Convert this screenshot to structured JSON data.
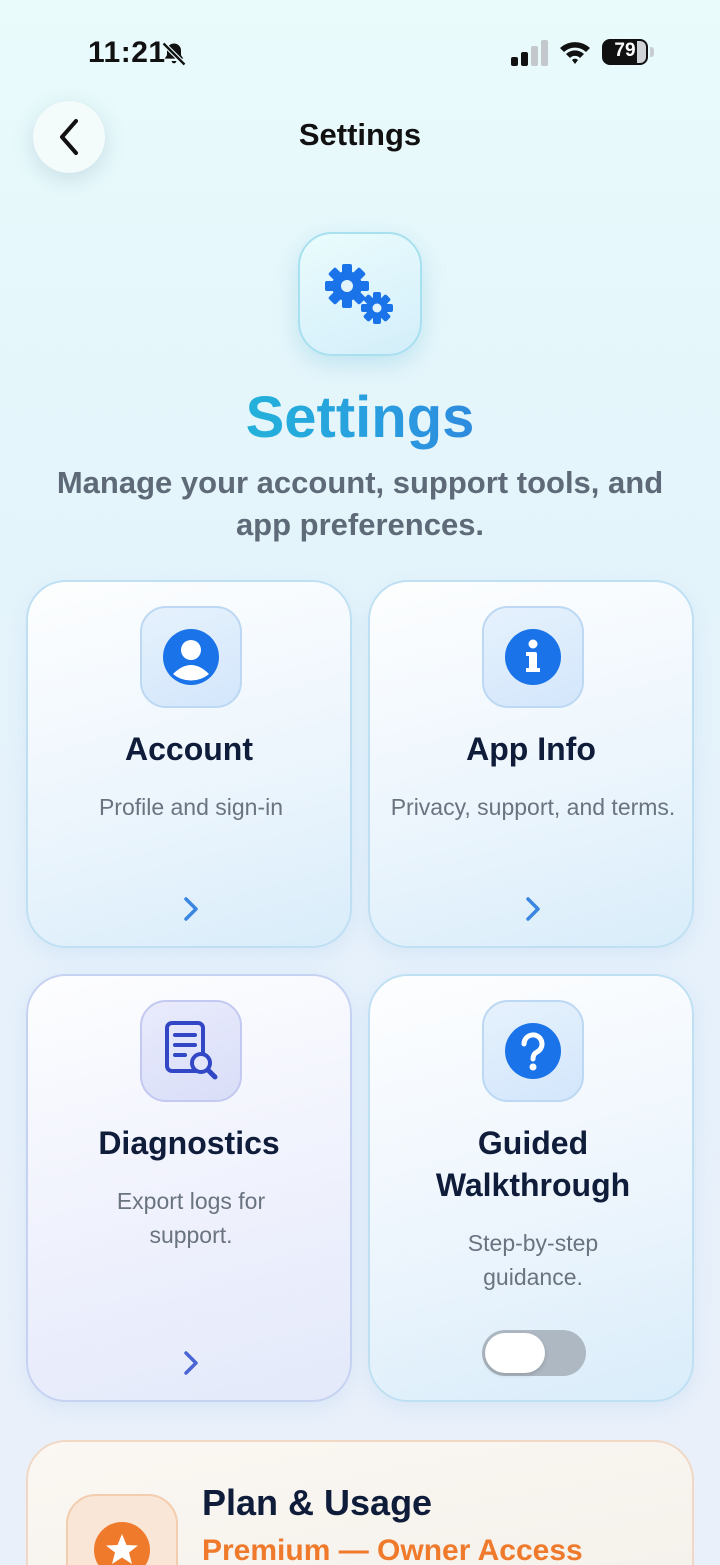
{
  "status_bar": {
    "time": "11:21",
    "battery": "79"
  },
  "nav": {
    "title": "Settings"
  },
  "hero": {
    "title": "Settings",
    "subtitle": "Manage your account, support tools, and app preferences."
  },
  "cards": [
    {
      "title": "Account",
      "description": "Profile and sign-in",
      "icon": "person-icon"
    },
    {
      "title": "App Info",
      "description": "Privacy, support, and terms.",
      "icon": "info-icon"
    },
    {
      "title": "Diagnostics",
      "description": "Export logs for support.",
      "icon": "document-search-icon"
    },
    {
      "title": "Guided Walkthrough",
      "description": "Step-by-step guidance.",
      "icon": "question-icon",
      "toggle_on": false
    }
  ],
  "plan": {
    "title": "Plan & Usage",
    "subtitle": "Premium — Owner Access",
    "icon": "star-icon"
  },
  "colors": {
    "accent_blue": "#1a73e8",
    "accent_orange": "#ef7a2b",
    "title_gradient": [
      "#17d6d1",
      "#3a56d6"
    ]
  }
}
